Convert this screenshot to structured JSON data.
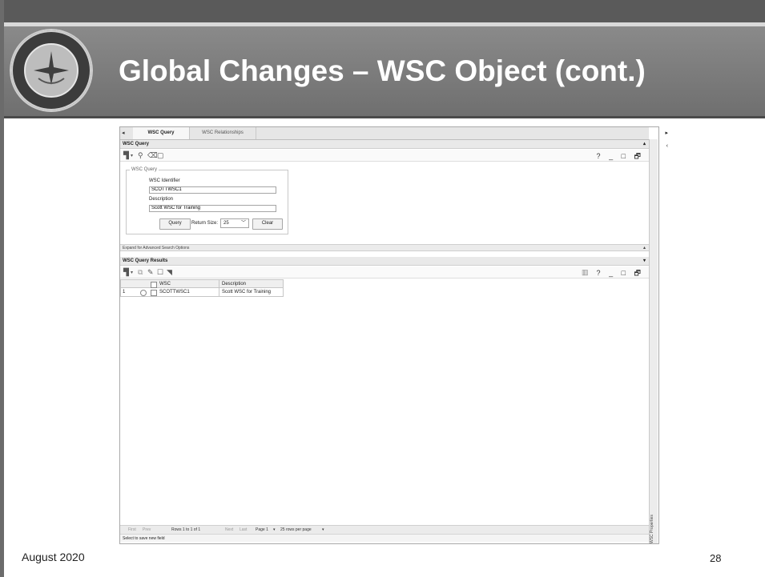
{
  "slide": {
    "title": "Global Changes – WSC Object (cont.)",
    "footer_date": "August 2020",
    "page_number": "28"
  },
  "tabs": [
    {
      "label": "WSC Query",
      "active": true
    },
    {
      "label": "WSC Relationships",
      "active": false
    }
  ],
  "query_section": {
    "header": "WSC Query",
    "group_label": "WSC Query",
    "identifier_label": "WSC Identifier",
    "identifier_value": "SCOTTWSC1",
    "description_label": "Description",
    "description_value": "Scott WSC for Training",
    "query_button": "Query",
    "return_size_label": "Return Size:",
    "return_size_value": "25",
    "clear_button": "Clear"
  },
  "advanced_search": {
    "label": "Expand for Advanced Search Options"
  },
  "results_section": {
    "header": "WSC Query Results",
    "columns": [
      "WSC",
      "Description"
    ],
    "rows": [
      {
        "index": "1",
        "wsc": "SCOTTWSC1",
        "description": "Scott WSC for Training"
      }
    ]
  },
  "pager": {
    "first": "First",
    "prev": "Prev",
    "rows_info": "Rows 1 to 1 of 1",
    "next": "Next",
    "last": "Last",
    "page": "Page 1",
    "per_page": "25 rows per page"
  },
  "status_bar": {
    "message": "Select to save new field"
  },
  "side_panel": {
    "label": "WSC Properties"
  },
  "window_controls": {
    "help": "?",
    "minimize": "_",
    "maximize": "□",
    "restore": "🗗"
  },
  "icons": {
    "new": "new-doc-icon",
    "search": "search-icon",
    "clear": "eraser-icon",
    "copy": "copy-icon"
  },
  "colors": {
    "title_bar": "#7a7a7a",
    "title_text": "#ffffff"
  }
}
